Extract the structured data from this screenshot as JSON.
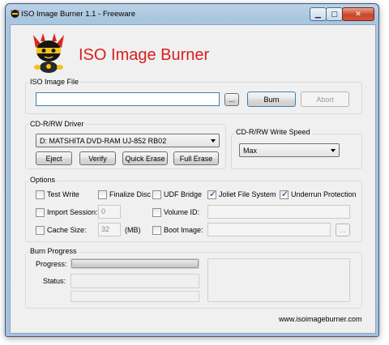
{
  "window": {
    "title": "ISO Image Burner 1.1 - Freeware"
  },
  "header": {
    "app_name": "ISO Image Burner",
    "app_name_color": "#d81e1e"
  },
  "iso_file": {
    "group_label": "ISO Image File",
    "path_value": "",
    "browse_label": "...",
    "burn_label": "Burn",
    "abort_label": "Abort"
  },
  "driver": {
    "group_label": "CD-R/RW Driver",
    "selected_drive": "D: MATSHITA DVD-RAM UJ-852  RB02",
    "eject_label": "Eject",
    "verify_label": "Verify",
    "quick_erase_label": "Quick Erase",
    "full_erase_label": "Full Erase"
  },
  "speed": {
    "group_label": "CD-R/RW Write Speed",
    "selected": "Max"
  },
  "options": {
    "group_label": "Options",
    "test_write": {
      "label": "Test Write",
      "checked": false
    },
    "finalize_disc": {
      "label": "Finalize Disc",
      "checked": false
    },
    "udf_bridge": {
      "label": "UDF Bridge",
      "checked": false
    },
    "joliet": {
      "label": "Joliet File System",
      "checked": true
    },
    "underrun": {
      "label": "Underrun Protection",
      "checked": true
    },
    "import_session": {
      "label": "Import Session:",
      "checked": false,
      "value": "0"
    },
    "volume_id": {
      "label": "Volume ID:",
      "checked": false,
      "value": ""
    },
    "cache_size": {
      "label": "Cache Size:",
      "checked": false,
      "value": "32",
      "unit": "(MB)"
    },
    "boot_image": {
      "label": "Boot Image:",
      "checked": false,
      "value": "",
      "browse_label": "..."
    }
  },
  "progress": {
    "group_label": "Burn Progress",
    "progress_label": "Progress:",
    "status_label": "Status:",
    "progress_fraction": 1.0,
    "status_text": ""
  },
  "footer": {
    "website": "www.isoimageburner.com"
  }
}
